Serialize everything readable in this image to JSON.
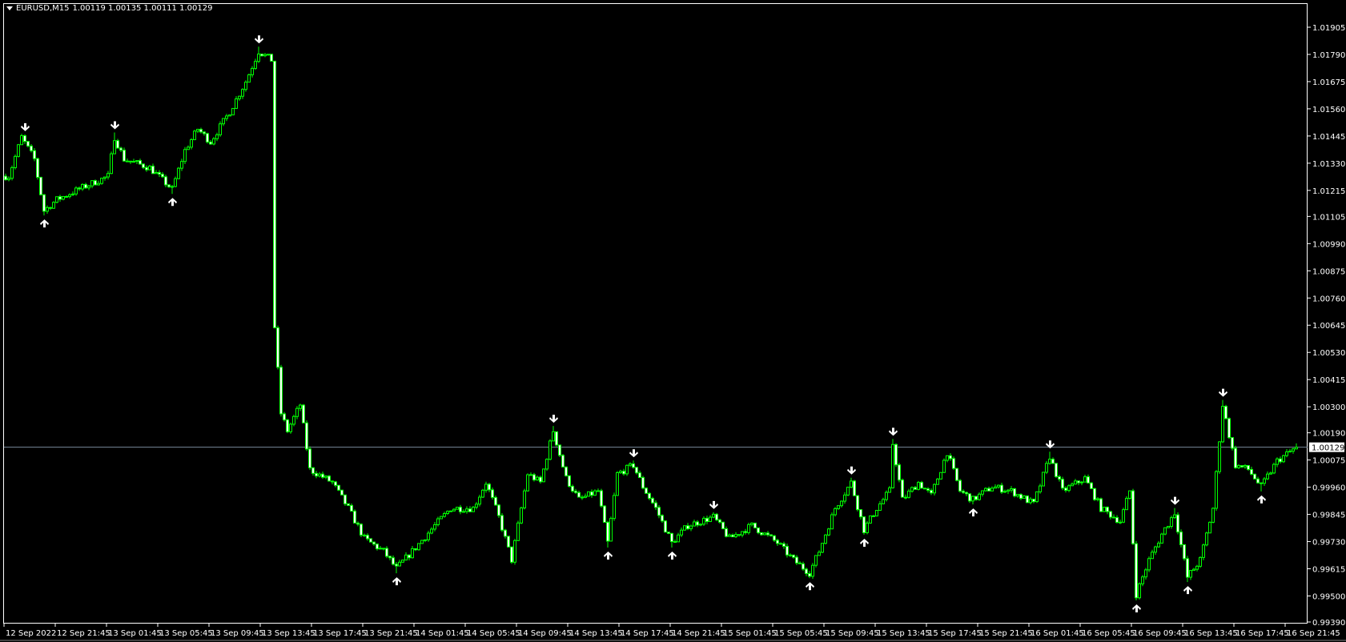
{
  "header": {
    "symbol": "EURUSD,M15",
    "ohlc": "1.00119 1.00135 1.00111 1.00129",
    "menu_icon": "triangle-down-icon"
  },
  "current_price": {
    "value": 1.00129,
    "label": "1.00129"
  },
  "colors": {
    "background": "#000000",
    "candle": "#00ff00",
    "bear_body": "#ffffff",
    "bull_body": "#000000",
    "arrow": "#ffffff",
    "price_line": "#778899",
    "axis": "#ffffff"
  },
  "chart_data": {
    "type": "candlestick",
    "title": "EURUSD,M15",
    "bar_count": 404,
    "ylim": [
      0.9939,
      1.01905
    ],
    "price_ticks": [
      "1.01905",
      "1.01790",
      "1.01675",
      "1.01560",
      "1.01445",
      "1.01330",
      "1.01215",
      "1.01105",
      "1.00990",
      "1.00875",
      "1.00760",
      "1.00645",
      "1.00530",
      "1.00415",
      "1.00300",
      "1.00190",
      "1.00075",
      "0.99960",
      "0.99845",
      "0.99730",
      "0.99615",
      "0.99500",
      "0.99390"
    ],
    "time_ticks": [
      "12 Sep 2022",
      "12 Sep 21:45",
      "13 Sep 01:45",
      "13 Sep 05:45",
      "13 Sep 09:45",
      "13 Sep 13:45",
      "13 Sep 17:45",
      "13 Sep 21:45",
      "14 Sep 01:45",
      "14 Sep 05:45",
      "14 Sep 09:45",
      "14 Sep 13:45",
      "14 Sep 17:45",
      "14 Sep 21:45",
      "15 Sep 01:45",
      "15 Sep 05:45",
      "15 Sep 09:45",
      "15 Sep 13:45",
      "15 Sep 17:45",
      "15 Sep 21:45",
      "16 Sep 01:45",
      "16 Sep 05:45",
      "16 Sep 09:45",
      "16 Sep 13:45",
      "16 Sep 17:45",
      "16 Sep 21:45"
    ],
    "bars_per_time_tick": 16,
    "price_path": [
      [
        1,
        1.01275
      ],
      [
        5,
        1.0144
      ],
      [
        9,
        1.01347
      ],
      [
        12,
        1.01129
      ],
      [
        16,
        1.01176
      ],
      [
        24,
        1.01227
      ],
      [
        32,
        1.01275
      ],
      [
        34,
        1.0144
      ],
      [
        37,
        1.01347
      ],
      [
        45,
        1.01311
      ],
      [
        52,
        1.0122
      ],
      [
        56,
        1.01384
      ],
      [
        60,
        1.01475
      ],
      [
        64,
        1.0142
      ],
      [
        70,
        1.01548
      ],
      [
        75,
        1.01675
      ],
      [
        79,
        1.01803
      ],
      [
        83,
        1.01767
      ],
      [
        84,
        1.00637
      ],
      [
        86,
        1.00272
      ],
      [
        88,
        1.00199
      ],
      [
        92,
        1.00309
      ],
      [
        95,
        1.00035
      ],
      [
        102,
        0.9998
      ],
      [
        107,
        0.99871
      ],
      [
        112,
        0.99743
      ],
      [
        118,
        0.99689
      ],
      [
        122,
        0.99616
      ],
      [
        127,
        0.99689
      ],
      [
        134,
        0.99798
      ],
      [
        139,
        0.99871
      ],
      [
        146,
        0.99871
      ],
      [
        150,
        0.9998
      ],
      [
        154,
        0.99834
      ],
      [
        158,
        0.99652
      ],
      [
        163,
        1.00016
      ],
      [
        167,
        0.9998
      ],
      [
        171,
        1.00199
      ],
      [
        175,
        0.99998
      ],
      [
        179,
        0.99907
      ],
      [
        185,
        0.99944
      ],
      [
        188,
        0.99725
      ],
      [
        191,
        1.00016
      ],
      [
        196,
        1.00053
      ],
      [
        199,
        0.99962
      ],
      [
        203,
        0.99871
      ],
      [
        208,
        0.99725
      ],
      [
        213,
        0.99798
      ],
      [
        221,
        0.99834
      ],
      [
        226,
        0.99743
      ],
      [
        233,
        0.99798
      ],
      [
        241,
        0.99725
      ],
      [
        246,
        0.99652
      ],
      [
        251,
        0.99598
      ],
      [
        254,
        0.99689
      ],
      [
        259,
        0.99871
      ],
      [
        264,
        0.9998
      ],
      [
        268,
        0.9978
      ],
      [
        272,
        0.99871
      ],
      [
        276,
        0.99944
      ],
      [
        277,
        1.00144
      ],
      [
        280,
        0.99907
      ],
      [
        285,
        0.9998
      ],
      [
        289,
        0.99925
      ],
      [
        294,
        1.00108
      ],
      [
        298,
        0.99944
      ],
      [
        302,
        0.99907
      ],
      [
        308,
        0.99962
      ],
      [
        314,
        0.99944
      ],
      [
        321,
        0.99889
      ],
      [
        326,
        1.0009
      ],
      [
        330,
        0.99944
      ],
      [
        337,
        0.99998
      ],
      [
        342,
        0.99871
      ],
      [
        348,
        0.99816
      ],
      [
        351,
        0.99944
      ],
      [
        353,
        0.99507
      ],
      [
        357,
        0.99652
      ],
      [
        361,
        0.99761
      ],
      [
        365,
        0.99852
      ],
      [
        369,
        0.99579
      ],
      [
        373,
        0.99652
      ],
      [
        377,
        0.99871
      ],
      [
        380,
        1.00309
      ],
      [
        384,
        1.00053
      ],
      [
        388,
        1.00035
      ],
      [
        392,
        0.99962
      ],
      [
        397,
        1.00071
      ],
      [
        403,
        1.00129
      ]
    ],
    "fractal_up_arrows": [
      12,
      52,
      122,
      188,
      208,
      251,
      268,
      302,
      353,
      369,
      392
    ],
    "fractal_down_arrows": [
      6,
      34,
      79,
      171,
      196,
      221,
      264,
      277,
      326,
      365,
      380
    ]
  }
}
